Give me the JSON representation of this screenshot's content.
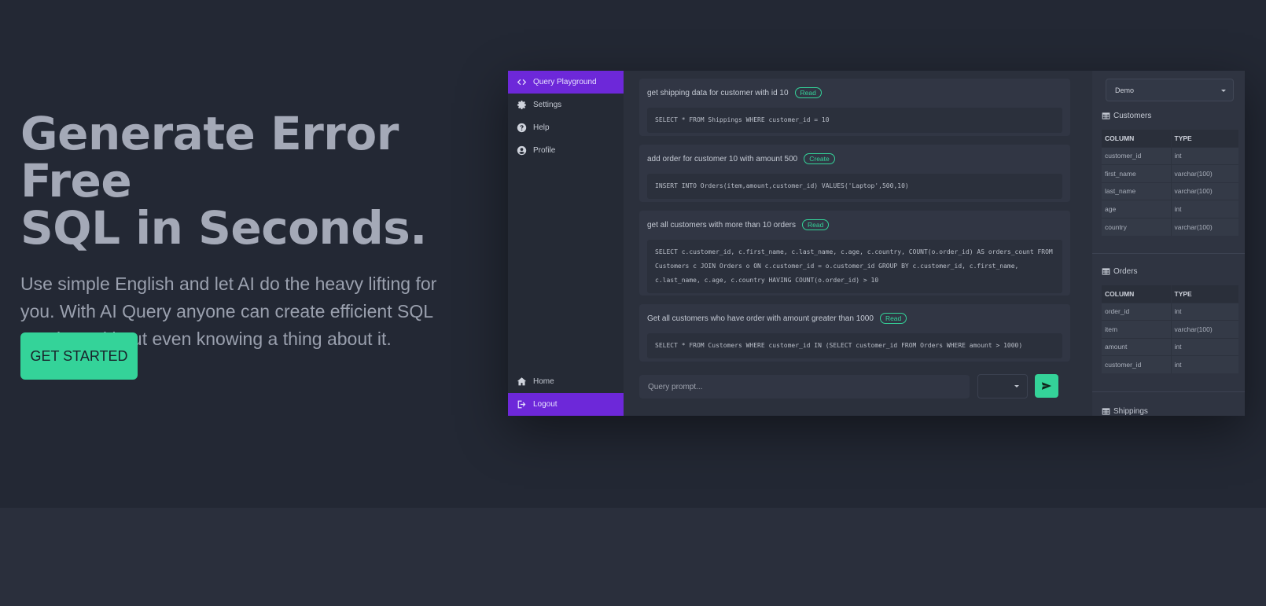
{
  "hero": {
    "title_line1": "Generate Error Free",
    "title_line2": "SQL in Seconds.",
    "description": "Use simple English and let AI do the heavy lifting for you. With AI Query anyone can create efficient SQL queries, without even knowing a thing about it.",
    "cta_label": "GET STARTED"
  },
  "sidebar": {
    "items": [
      {
        "label": "Query Playground",
        "icon": "code-icon"
      },
      {
        "label": "Settings",
        "icon": "gear-icon"
      },
      {
        "label": "Help",
        "icon": "help-icon"
      },
      {
        "label": "Profile",
        "icon": "user-icon"
      }
    ],
    "bottom_items": [
      {
        "label": "Home",
        "icon": "home-icon"
      },
      {
        "label": "Logout",
        "icon": "logout-icon"
      }
    ]
  },
  "queries": [
    {
      "prompt": "get shipping data for customer with id 10",
      "badge": "Read",
      "sql": [
        "SELECT * FROM Shippings WHERE customer_id = 10"
      ]
    },
    {
      "prompt": "add order for customer 10 with amount 500",
      "badge": "Create",
      "sql": [
        "INSERT INTO Orders(item,amount,customer_id) VALUES('Laptop',500,10)"
      ]
    },
    {
      "prompt": "get all customers with more than 10 orders",
      "badge": "Read",
      "sql": [
        "SELECT c.customer_id, c.first_name, c.last_name, c.age, c.country, COUNT(o.order_id) AS orders_count FROM",
        "Customers c JOIN Orders o ON c.customer_id = o.customer_id GROUP BY c.customer_id, c.first_name,",
        "c.last_name, c.age, c.country HAVING COUNT(o.order_id) > 10"
      ]
    },
    {
      "prompt": "Get all customers who have order with amount greater than 1000",
      "badge": "Read",
      "sql": [
        "SELECT * FROM Customers WHERE customer_id IN (SELECT customer_id FROM Orders WHERE amount > 1000)"
      ]
    }
  ],
  "prompt_input": {
    "placeholder": "Query prompt..."
  },
  "schema": {
    "database": "Demo",
    "column_header": "COLUMN",
    "type_header": "TYPE",
    "tables": [
      {
        "name": "Customers",
        "rows": [
          [
            "customer_id",
            "int"
          ],
          [
            "first_name",
            "varchar(100)"
          ],
          [
            "last_name",
            "varchar(100)"
          ],
          [
            "age",
            "int"
          ],
          [
            "country",
            "varchar(100)"
          ]
        ]
      },
      {
        "name": "Orders",
        "rows": [
          [
            "order_id",
            "int"
          ],
          [
            "item",
            "varchar(100)"
          ],
          [
            "amount",
            "int"
          ],
          [
            "customer_id",
            "int"
          ]
        ]
      },
      {
        "name": "Shippings",
        "rows": []
      }
    ]
  },
  "colors": {
    "accent": "#6d28d9",
    "brand_green": "#34d399",
    "background": "#232834"
  }
}
